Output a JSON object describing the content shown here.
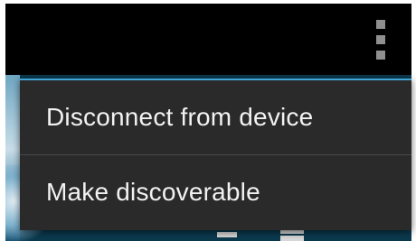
{
  "action_bar": {
    "overflow_icon": "overflow-menu-icon"
  },
  "menu": {
    "items": [
      {
        "label": "Disconnect from device"
      },
      {
        "label": "Make discoverable"
      }
    ],
    "accent_color": "#3fa6d6"
  }
}
